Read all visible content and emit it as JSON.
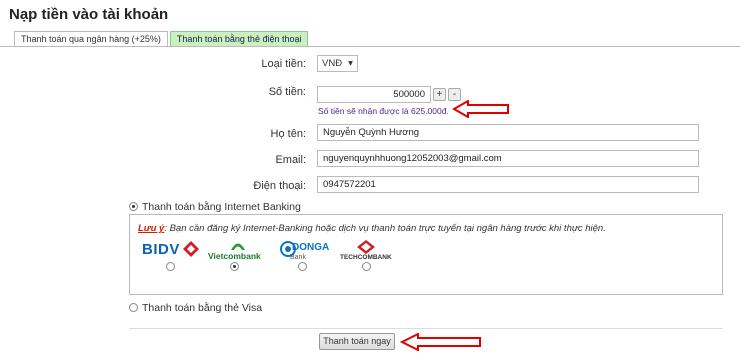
{
  "page": {
    "title": "Nạp tiền vào tài khoản"
  },
  "tabs": [
    {
      "label": "Thanh toán qua ngân hàng (+25%)",
      "active": true
    },
    {
      "label": "Thanh toán bằng thẻ điện thoại",
      "active": false
    }
  ],
  "form": {
    "currency": {
      "label": "Loại tiền:",
      "value": "VNĐ"
    },
    "amount": {
      "label": "Số tiền:",
      "value": "500000",
      "plus": "+",
      "minus": "-",
      "hint": "Số tiền sẽ nhận được là 625.000đ."
    },
    "name": {
      "label": "Họ tên:",
      "value": "Nguyễn Quỳnh Hương"
    },
    "email": {
      "label": "Email:",
      "value": "nguyenquynhhuong12052003@gmail.com"
    },
    "phone": {
      "label": "Điện thoại:",
      "value": "0947572201"
    }
  },
  "payment": {
    "internet_banking": {
      "label": "Thanh toán bằng Internet Banking",
      "selected": true
    },
    "note_key": "Lưu ý",
    "note_text": ": Bạn cần đăng ký Internet-Banking hoặc dịch vụ thanh toán trực tuyến tại ngân hàng trước khi thực hiện.",
    "banks": [
      {
        "name": "BIDV",
        "selected": false
      },
      {
        "name": "Vietcombank",
        "selected": true
      },
      {
        "name": "DONGA Bank",
        "selected": false
      },
      {
        "name": "TECHCOMBANK",
        "selected": false
      }
    ],
    "visa": {
      "label": "Thanh toán bằng thẻ Visa",
      "selected": false
    }
  },
  "submit": {
    "label": "Thanh toán ngay"
  },
  "colors": {
    "annotation_arrow": "#e00000",
    "tab_inactive": "#c8f0c0",
    "hint": "#4b2a8a"
  }
}
